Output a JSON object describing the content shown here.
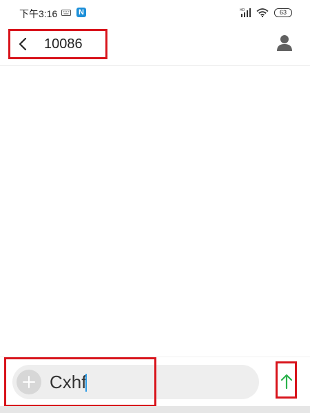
{
  "status_bar": {
    "time": "下午3:16",
    "notification_badge": "N",
    "battery_level": "63",
    "signal_label": "HD",
    "icons": [
      "keyboard-icon",
      "signal-icon",
      "wifi-icon",
      "battery-icon"
    ]
  },
  "header": {
    "title": "10086",
    "back_icon": "chevron-left-icon",
    "contact_icon": "person-icon"
  },
  "composer": {
    "add_icon": "plus-icon",
    "input_value": "Cxhf",
    "send_icon": "arrow-up-icon"
  },
  "colors": {
    "highlight": "#d8141c",
    "send_arrow": "#2bb24c",
    "caret": "#2b9be6",
    "badge": "#1d8fd8"
  }
}
